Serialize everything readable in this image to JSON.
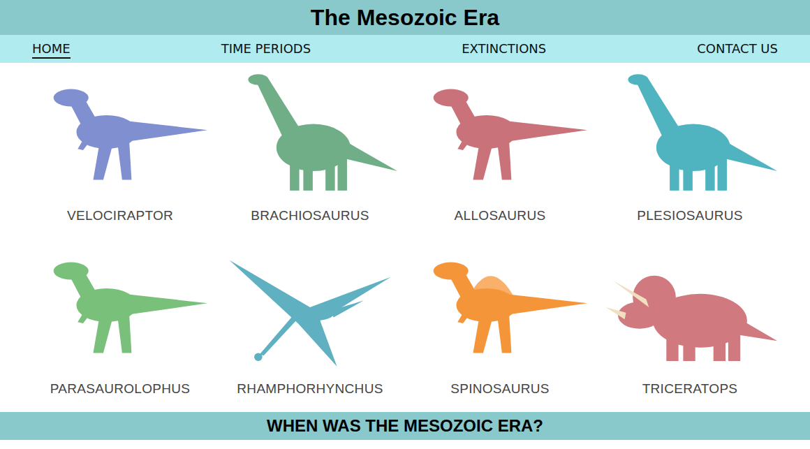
{
  "header": {
    "title": "The Mesozoic Era"
  },
  "nav": [
    {
      "label": "HOME",
      "selected": true
    },
    {
      "label": "TIME PERIODS",
      "selected": false
    },
    {
      "label": "EXTINCTIONS",
      "selected": false
    },
    {
      "label": "CONTACT US",
      "selected": false
    }
  ],
  "dinosaurs": [
    {
      "name": "VELOCIRAPTOR",
      "kind": "biped",
      "color": "#7f8fd0"
    },
    {
      "name": "BRACHIOSAURUS",
      "kind": "longneck",
      "color": "#6fae86"
    },
    {
      "name": "ALLOSAURUS",
      "kind": "biped",
      "color": "#c9727a"
    },
    {
      "name": "PLESIOSAURUS",
      "kind": "longneck",
      "color": "#4fb3c0"
    },
    {
      "name": "PARASAUROLOPHUS",
      "kind": "biped",
      "color": "#79c07a"
    },
    {
      "name": "RHAMPHORHYNCHUS",
      "kind": "flyer",
      "color": "#5fb0c0"
    },
    {
      "name": "SPINOSAURUS",
      "kind": "sail",
      "color": "#f5953a"
    },
    {
      "name": "TRICERATOPS",
      "kind": "horned",
      "color": "#d07a80"
    }
  ],
  "footer": {
    "heading": "WHEN WAS THE MESOZOIC ERA?"
  }
}
